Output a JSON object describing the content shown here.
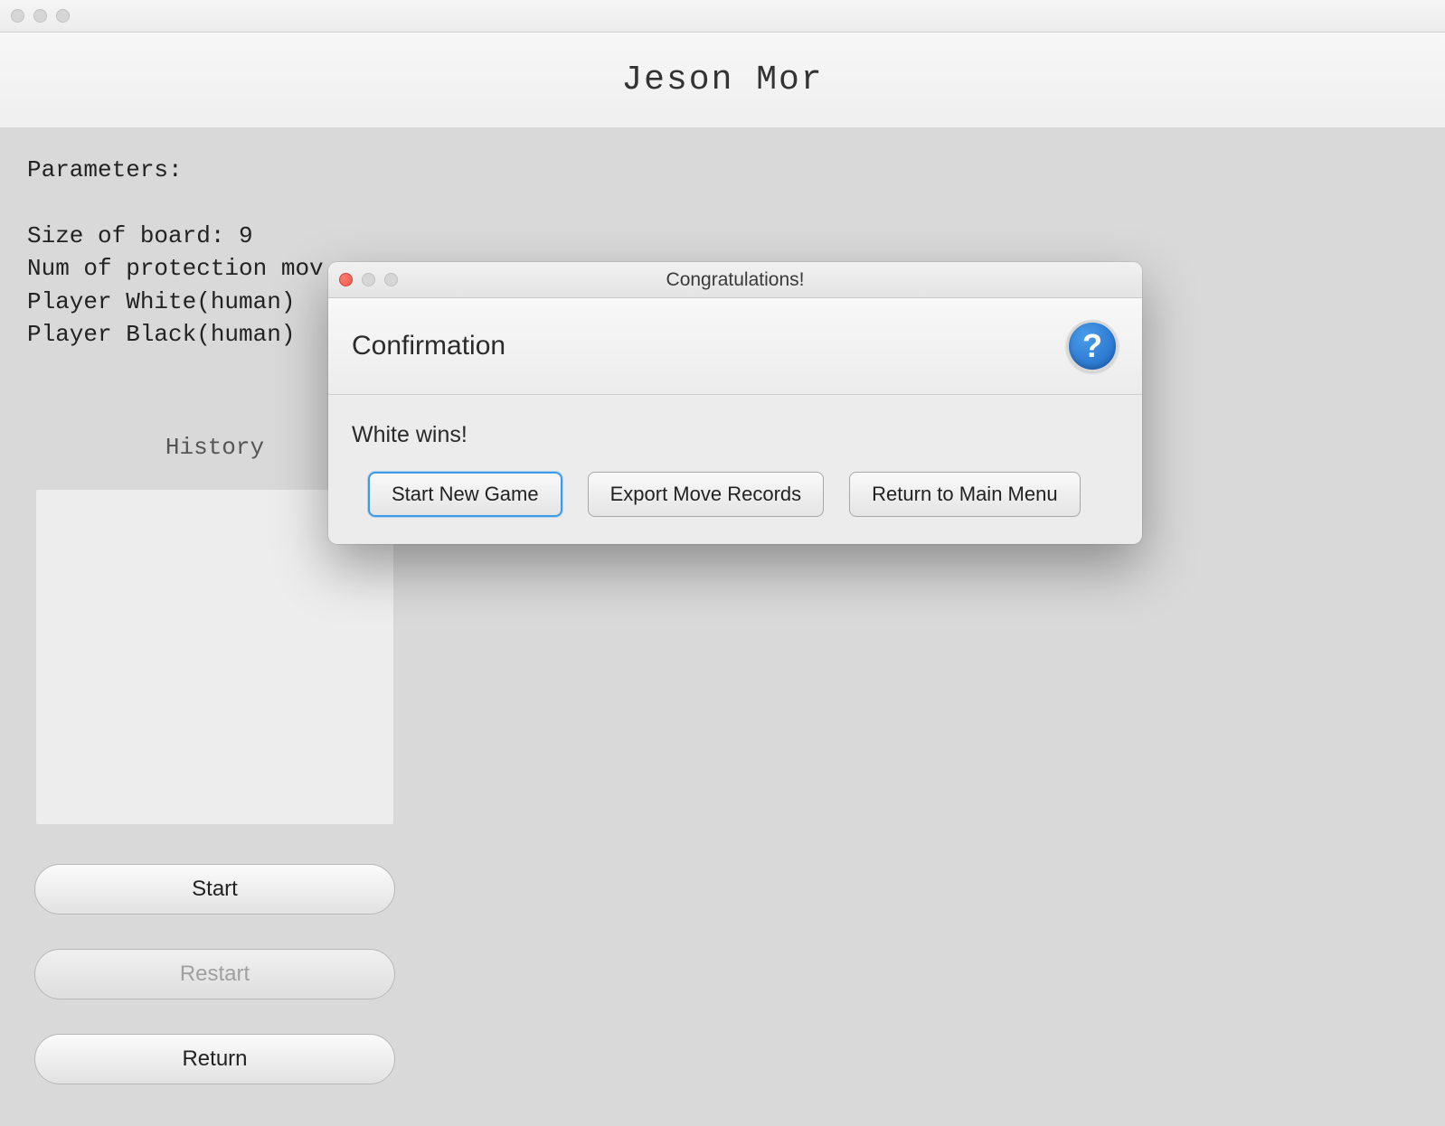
{
  "window": {
    "title": "Jeson Mor"
  },
  "sidebar": {
    "params_label": "Parameters:",
    "lines": {
      "board_size": "Size of board: 9",
      "protection": "Num of protection mov",
      "player_white": "Player White(human)",
      "player_black": "Player Black(human)"
    },
    "history_label": "History",
    "buttons": {
      "start": "Start",
      "restart": "Restart",
      "return": "Return"
    }
  },
  "dialog": {
    "title": "Congratulations!",
    "header": "Confirmation",
    "message": "White wins!",
    "buttons": {
      "new_game": "Start New Game",
      "export": "Export Move Records",
      "main_menu": "Return to Main Menu"
    }
  }
}
